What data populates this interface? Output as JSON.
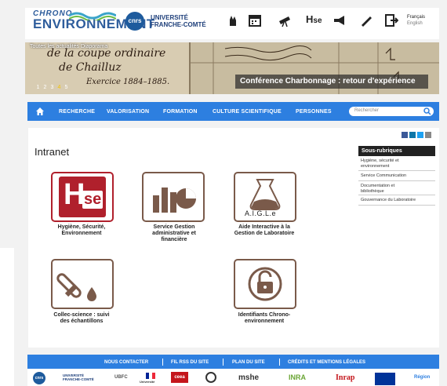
{
  "header": {
    "logo_line1": "CHRONO",
    "logo_line2": "ENVIRONNEMENT",
    "cnrs": "cnrs",
    "univ_line1": "UNIVERSITÉ",
    "univ_line2": "FRANCHE-COMTÉ",
    "lang_fr": "Français",
    "lang_en": "English",
    "icons": [
      "hand-icon",
      "calendar-icon",
      "telescope-icon",
      "hse-icon",
      "megaphone-icon",
      "pen-icon",
      "logout-icon"
    ]
  },
  "banner": {
    "links": "Toutes les actualités  Diaporama",
    "caption": "Conférence Charbonnage : retour d'expérience",
    "dots": [
      "1",
      "2",
      "3",
      "4",
      "5"
    ],
    "active_dot": "4",
    "script1": "de la coupe ordinaire",
    "script2": "de Chailluz",
    "script3": "Exercice 1884–1885."
  },
  "nav": {
    "items": [
      "RECHERCHE",
      "VALORISATION",
      "FORMATION",
      "CULTURE SCIENTIFIQUE",
      "PERSONNES"
    ],
    "search_placeholder": "Rechercher"
  },
  "main": {
    "title": "Intranet",
    "cards": [
      {
        "label1": "Hygiène, Sécurité,",
        "label2": "Environnement",
        "label3": ""
      },
      {
        "label1": "Service Gestion",
        "label2": "administrative et",
        "label3": "financière"
      },
      {
        "label1": "Aide Interactive à la",
        "label2": "Gestion de Laboratoire",
        "label3": ""
      },
      {
        "label1": "Collec-science : suivi",
        "label2": "des échantillons",
        "label3": ""
      },
      {
        "label1": "Identifiants Chrono-",
        "label2": "environnement",
        "label3": ""
      }
    ],
    "hse_text": "Hse",
    "aigle_text": "A.I.G.L.e"
  },
  "sidebar": {
    "header": "Sous-rubriques",
    "items": [
      {
        "l1": "Hygiène, sécurité et",
        "l2": "environnement"
      },
      {
        "l1": "Service Communication",
        "l2": ""
      },
      {
        "l1": "Documentation et",
        "l2": "bibliothèque"
      },
      {
        "l1": "Gouvernance du Laboratoire",
        "l2": ""
      }
    ]
  },
  "footer": {
    "links": [
      "NOUS CONTACTER",
      "FIL RSS DU SITE",
      "PLAN DU SITE",
      "CRÉDITS ET MENTIONS LÉGALES"
    ],
    "partners": [
      "cnrs",
      "UNIVERSITÉ FRANCHE-COMTÉ",
      "UBFC",
      "Université",
      "ceea",
      "OSU",
      "mshe",
      "INRA",
      "Inrap",
      "EU",
      "Région"
    ]
  },
  "colors": {
    "nav_blue": "#2d7fe0",
    "icon_brown": "#7a5a4a",
    "hse_red": "#b0202c"
  }
}
